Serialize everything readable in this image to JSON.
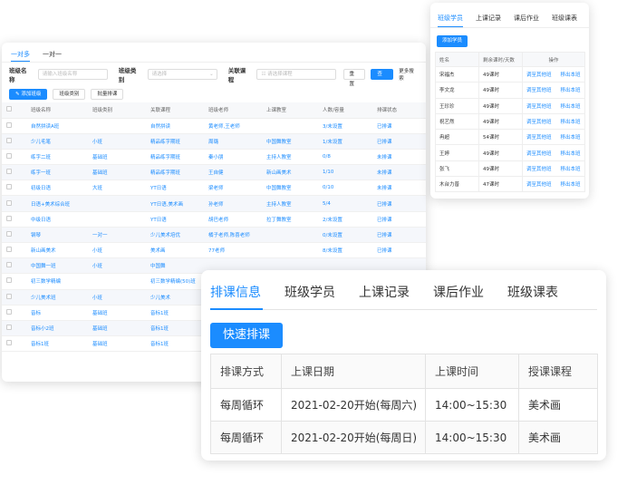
{
  "main": {
    "tabs": [
      "一对多",
      "一对一"
    ],
    "filters": {
      "class_name_label": "班级名称",
      "class_name_placeholder": "请输入班级名称",
      "class_type_label": "班级类别",
      "class_type_placeholder": "请选择",
      "course_label": "关联课程",
      "course_placeholder": "请选择课程",
      "reset": "重置",
      "query": "查询",
      "more": "更多搜索"
    },
    "actions": [
      "添加班级",
      "班级类别",
      "批量排课"
    ],
    "columns": [
      "",
      "班级名称",
      "班级类别",
      "关联课程",
      "班级老师",
      "上课教室",
      "人数/容量",
      "排课状态",
      "",
      ""
    ],
    "rows": [
      [
        "",
        "自然拼读A班",
        "",
        "自然拼读",
        "黄老师,王老师",
        "",
        "3/未设置",
        "已排课",
        "",
        ""
      ],
      [
        "",
        "少儿毛笔",
        "小班",
        "精品练字期班",
        "周璐",
        "中国舞教室",
        "1/未设置",
        "已排课",
        "",
        ""
      ],
      [
        "",
        "练字二班",
        "基础班",
        "精品练字期班",
        "秦小朋",
        "主持人教室",
        "0/8",
        "未排课",
        "",
        ""
      ],
      [
        "",
        "练字一班",
        "基础班",
        "精品练字期班",
        "王自健",
        "新山画美术",
        "1/10",
        "未排课",
        "",
        ""
      ],
      [
        "",
        "初级日语",
        "大班",
        "YT日语",
        "梁老师",
        "中国舞教室",
        "0/10",
        "未排课",
        "",
        ""
      ],
      [
        "",
        "日语+美术综合班",
        "",
        "YT日语,美术画",
        "孙老师",
        "主持人教室",
        "5/4",
        "已排课",
        "0",
        "0"
      ],
      [
        "",
        "中级日语",
        "",
        "YT日语",
        "胡巴老师",
        "拉丁舞教室",
        "2/未设置",
        "已排课",
        "0",
        "0"
      ],
      [
        "",
        "钢琴",
        "一对一",
        "少儿美术培优",
        "橘子老师,陈喜老师",
        "",
        "0/未设置",
        "已排课",
        "0",
        "0"
      ],
      [
        "",
        "新山画美术",
        "小班",
        "美术画",
        "77老师",
        "",
        "8/未设置",
        "已排课",
        "0",
        "0"
      ],
      [
        "",
        "中国舞一班",
        "小班",
        "中国舞",
        "",
        "",
        "",
        "",
        "",
        ""
      ],
      [
        "",
        "初三数学精编",
        "",
        "初三数学精编(50)班",
        "",
        "",
        "",
        "",
        "",
        ""
      ],
      [
        "",
        "少儿美术班",
        "小班",
        "少儿美术",
        "",
        "",
        "",
        "",
        "",
        ""
      ],
      [
        "",
        "音标",
        "基础班",
        "音标1班",
        "",
        "",
        "",
        "",
        "",
        ""
      ],
      [
        "",
        "音标小2班",
        "基础班",
        "音标1班",
        "",
        "",
        "",
        "",
        "",
        ""
      ],
      [
        "",
        "音标1班",
        "基础班",
        "音标1班",
        "",
        "",
        "",
        "",
        "",
        ""
      ]
    ]
  },
  "students_panel": {
    "tabs": [
      "班级学员",
      "上课记录",
      "课后作业",
      "班级课表"
    ],
    "add_button": "添加学员",
    "columns": [
      "姓名",
      "剩余课时/天数",
      "操作"
    ],
    "row_actions": [
      "调至其他班",
      "移出本班"
    ],
    "rows": [
      [
        "宋福杰",
        "49课时"
      ],
      [
        "李文龙",
        "49课时"
      ],
      [
        "王珍珍",
        "49课时"
      ],
      [
        "祝艺然",
        "49课时"
      ],
      [
        "冉超",
        "54课时"
      ],
      [
        "王婷",
        "49课时"
      ],
      [
        "张飞",
        "49课时"
      ],
      [
        "木台力普",
        "47课时"
      ]
    ]
  },
  "schedule_panel": {
    "tabs": [
      "排课信息",
      "班级学员",
      "上课记录",
      "课后作业",
      "班级课表"
    ],
    "primary_button": "快速排课",
    "columns": [
      "排课方式",
      "上课日期",
      "上课时间",
      "授课课程"
    ],
    "rows": [
      [
        "每周循环",
        "2021-02-20开始(每周六)",
        "14:00~15:30",
        "美术画"
      ],
      [
        "每周循环",
        "2021-02-20开始(每周日)",
        "14:00~15:30",
        "美术画"
      ]
    ]
  },
  "colors": {
    "accent": "#1b8cff"
  }
}
